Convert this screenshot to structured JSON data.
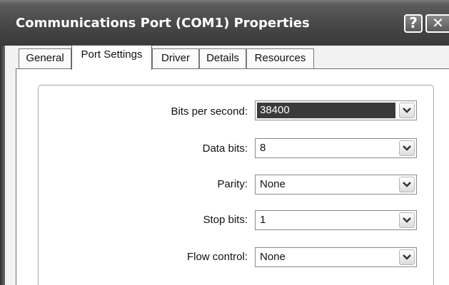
{
  "window": {
    "title": "Communications Port (COM1) Properties",
    "help_button": "?",
    "close_button": "✕"
  },
  "tabs": [
    {
      "label": "General",
      "active": false
    },
    {
      "label": "Port Settings",
      "active": true
    },
    {
      "label": "Driver",
      "active": false
    },
    {
      "label": "Details",
      "active": false
    },
    {
      "label": "Resources",
      "active": false
    }
  ],
  "port_settings": {
    "bits_per_second": {
      "label": "Bits per second:",
      "value": "38400"
    },
    "data_bits": {
      "label": "Data bits:",
      "value": "8"
    },
    "parity": {
      "label": "Parity:",
      "value": "None"
    },
    "stop_bits": {
      "label": "Stop bits:",
      "value": "1"
    },
    "flow_control": {
      "label": "Flow control:",
      "value": "None"
    }
  },
  "icons": {
    "help": "question-mark-icon",
    "close": "close-x-icon",
    "dropdown": "chevron-down-icon"
  },
  "colors": {
    "titlebar": "#4a4a4a",
    "selection": "#3a3a3a",
    "body_bg": "#ffffff"
  }
}
